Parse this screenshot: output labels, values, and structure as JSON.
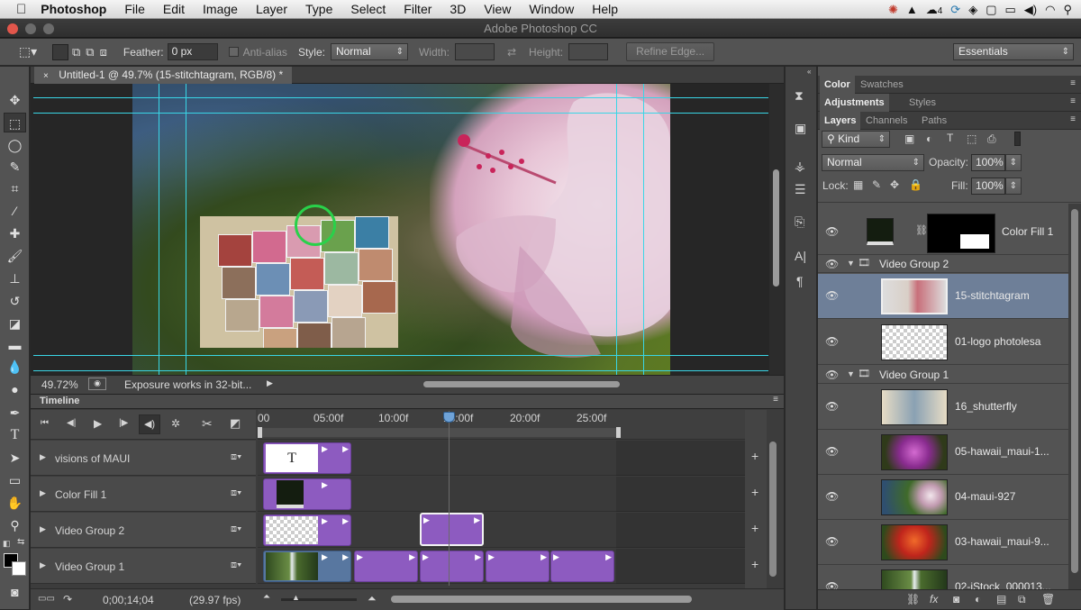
{
  "menubar": {
    "app": "Photoshop",
    "items": [
      "File",
      "Edit",
      "Image",
      "Layer",
      "Type",
      "Select",
      "Filter",
      "3D",
      "View",
      "Window",
      "Help"
    ],
    "badge_count": "4"
  },
  "window": {
    "title": "Adobe Photoshop CC"
  },
  "options": {
    "feather_label": "Feather:",
    "feather_value": "0 px",
    "antialias_label": "Anti-alias",
    "style_label": "Style:",
    "style_value": "Normal",
    "width_label": "Width:",
    "height_label": "Height:",
    "refine_edge": "Refine Edge...",
    "workspace": "Essentials"
  },
  "document": {
    "tab_title": "Untitled-1 @ 49.7% (15-stitchtagram, RGB/8) *",
    "zoom": "49.72%",
    "status_text": "Exposure works in 32-bit..."
  },
  "timeline": {
    "title": "Timeline",
    "ruler": [
      "00",
      "05:00f",
      "10:00f",
      "15:00f",
      "20:00f",
      "25:00f"
    ],
    "timecode": "0;00;14;04",
    "fps": "(29.97 fps)",
    "tracks": [
      "visions of MAUI",
      "Color Fill 1",
      "Video Group 2",
      "Video Group 1"
    ],
    "title_clip_glyph": "T"
  },
  "panels": {
    "tabs_row1": [
      "Color",
      "Swatches"
    ],
    "tabs_row2": [
      "Adjustments",
      "Styles"
    ],
    "tabs_row3": [
      "Layers",
      "Channels",
      "Paths"
    ],
    "filter_kind": "Kind",
    "blend_mode": "Normal",
    "opacity_label": "Opacity:",
    "opacity_value": "100%",
    "lock_label": "Lock:",
    "fill_label": "Fill:",
    "fill_value": "100%",
    "layers": [
      {
        "name": "Color Fill 1"
      },
      {
        "name": "Video Group 2",
        "group": true
      },
      {
        "name": "15-stitchtagram",
        "selected": true
      },
      {
        "name": "01-logo photolesa"
      },
      {
        "name": "Video Group 1",
        "group": true
      },
      {
        "name": "16_shutterfly"
      },
      {
        "name": "05-hawaii_maui-1..."
      },
      {
        "name": "04-maui-927"
      },
      {
        "name": "03-hawaii_maui-9..."
      },
      {
        "name": "02-iStock_000013..."
      }
    ]
  },
  "colors": {
    "clip_purple": "#8d5bc0",
    "guide_cyan": "#39d6e6",
    "selected_layer": "#6e7f98"
  }
}
